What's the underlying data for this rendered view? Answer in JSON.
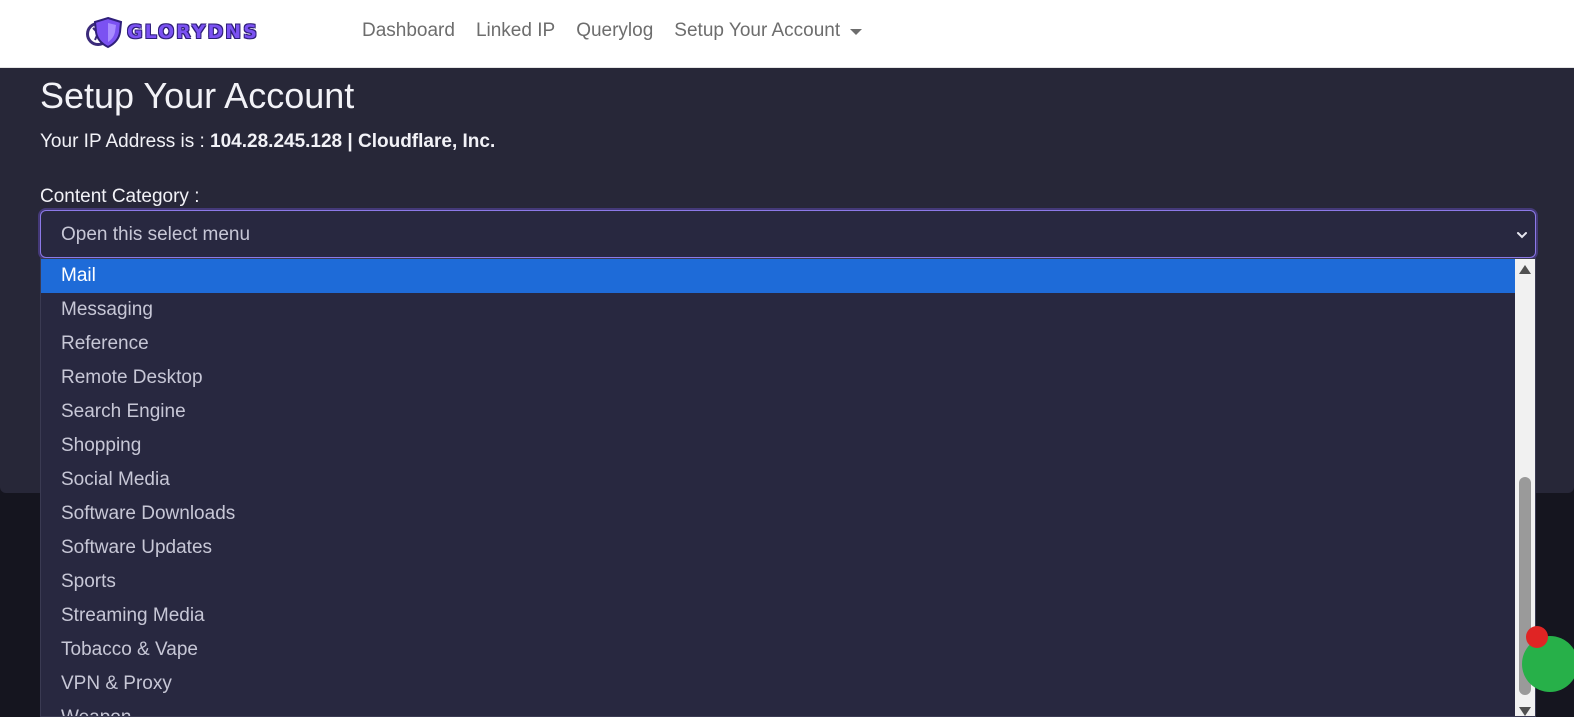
{
  "brand": {
    "name": "GLORYDNS"
  },
  "nav": {
    "links": [
      "Dashboard",
      "Linked IP",
      "Querylog"
    ],
    "dropdown_label": "Setup Your Account"
  },
  "page": {
    "title": "Setup Your Account",
    "ip_prefix": "Your IP Address is : ",
    "ip_value": "104.28.245.128 | Cloudflare, Inc."
  },
  "form": {
    "category_label": "Content Category :",
    "select_placeholder": "Open this select menu",
    "options": [
      "Mail",
      "Messaging",
      "Reference",
      "Remote Desktop",
      "Search Engine",
      "Shopping",
      "Social Media",
      "Software Downloads",
      "Software Updates",
      "Sports",
      "Streaming Media",
      "Tobacco & Vape",
      "VPN & Proxy",
      "Weapon"
    ],
    "highlighted_option": "Mail",
    "scroll_position": 0.62
  },
  "colors": {
    "accent": "#7b52f2",
    "highlight": "#1e6bd8",
    "card_background": "#272738",
    "page_background": "#15151f",
    "chat_widget": "#27b049",
    "notification_badge": "#e02424"
  },
  "icons": {
    "brand": "shield-logo-icon",
    "nav_dropdown": "caret-down-icon",
    "select": "chevron-down-icon",
    "scroll_up": "scroll-up-arrow-icon",
    "scroll_down": "scroll-down-arrow-icon",
    "widget": "chat-widget-icon"
  }
}
